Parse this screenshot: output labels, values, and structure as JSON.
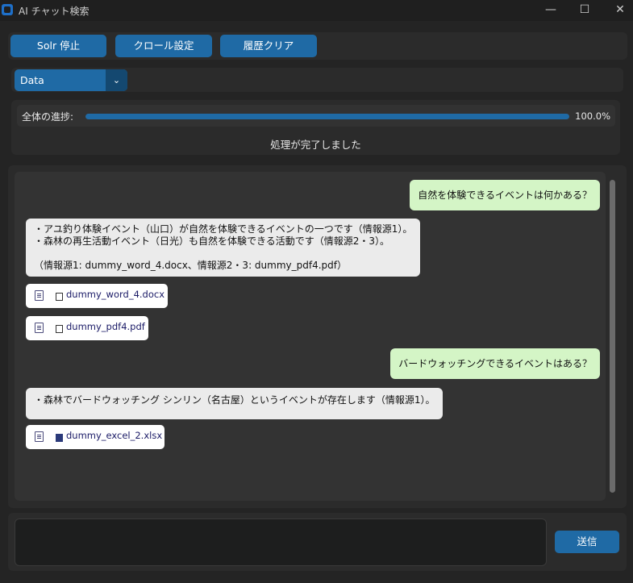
{
  "window": {
    "title": "AI チャット検索",
    "minimize": "—",
    "maximize": "☐",
    "close": "✕"
  },
  "toolbar": {
    "solr_stop": "Solr 停止",
    "crawl_settings": "クロール設定",
    "clear_history": "履歴クリア"
  },
  "collection_select": {
    "value": "Data",
    "arrow": "⌄"
  },
  "progress": {
    "label": "全体の進捗:",
    "value_percent": 100,
    "percent_text": "100.0%",
    "status": "処理が完了しました"
  },
  "chat": {
    "messages": [
      {
        "role": "user",
        "text": "自然を体験できるイベントは何かある？"
      },
      {
        "role": "bot",
        "text": "・アユ釣り体験イベント（山口）が自然を体験できるイベントの一つです（情報源1）。\n・森林の再生活動イベント（日光）も自然を体験できる活動です（情報源2・3）。\n\n（情報源1: dummy_word_4.docx、情報源2・3: dummy_pdf4.pdf）"
      },
      {
        "role": "file",
        "name": "dummy_word_4.docx"
      },
      {
        "role": "file",
        "name": "dummy_pdf4.pdf"
      },
      {
        "role": "user",
        "text": "バードウォッチングできるイベントはある？"
      },
      {
        "role": "bot",
        "text": "・森林でバードウォッチング シンリン（名古屋）というイベントが存在します（情報源1）。"
      },
      {
        "role": "file",
        "name": "dummy_excel_2.xlsx"
      }
    ]
  },
  "input": {
    "value": "",
    "send_label": "送信"
  },
  "colors": {
    "accent": "#1f6aa5",
    "user_bubble": "#d4f5c6",
    "bot_bubble": "#ebebeb",
    "background": "#242424"
  }
}
